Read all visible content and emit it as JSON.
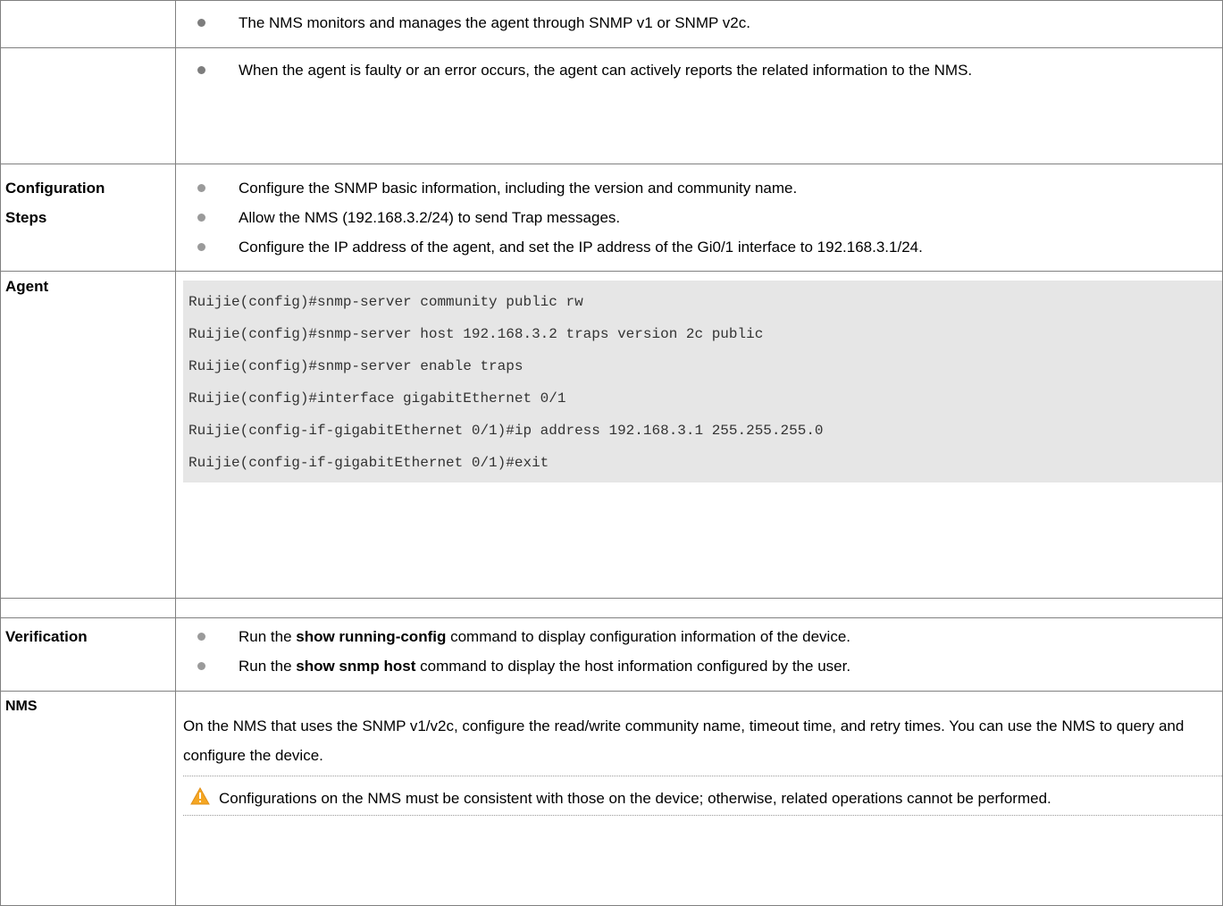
{
  "rows": {
    "r1": {
      "label": "",
      "bullets": [
        "The NMS monitors and manages the agent through SNMP v1 or SNMP v2c."
      ]
    },
    "r2": {
      "label": "",
      "bullets": [
        "When the agent is faulty or an error occurs, the agent can actively reports the related information to the NMS."
      ]
    },
    "config": {
      "label_line1": "Configuration",
      "label_line2": "Steps",
      "bullets": [
        "Configure the SNMP basic information, including the version and community name.",
        "Allow the NMS (192.168.3.2/24) to send Trap messages.",
        "Configure the IP address of the agent, and set the IP address of the Gi0/1 interface to 192.168.3.1/24."
      ]
    },
    "agent": {
      "label": "Agent",
      "code_lines": [
        "Ruijie(config)#snmp-server community public rw",
        "Ruijie(config)#snmp-server host 192.168.3.2 traps version 2c public",
        "Ruijie(config)#snmp-server enable traps",
        "Ruijie(config)#interface gigabitEthernet 0/1",
        "Ruijie(config-if-gigabitEthernet 0/1)#ip address 192.168.3.1 255.255.255.0",
        "Ruijie(config-if-gigabitEthernet 0/1)#exit"
      ]
    },
    "verification": {
      "label": "Verification",
      "items": [
        {
          "pre": "Run the ",
          "cmd": "show running-config",
          "post": " command to display configuration information of the device."
        },
        {
          "pre": "Run the ",
          "cmd": "show snmp host",
          "post": " command to display the host information configured by the user."
        }
      ]
    },
    "nms": {
      "label": "NMS",
      "paragraph": "On the NMS that uses the SNMP v1/v2c, configure the read/write community name, timeout time, and retry times. You can use the NMS to query and configure the device.",
      "note": "Configurations on the NMS must be consistent with those on the device; otherwise, related operations cannot be performed.",
      "note_icon": "warning-icon"
    }
  },
  "colors": {
    "border": "#808080",
    "code_bg": "#e6e6e6",
    "bullet": "#9a9a9a",
    "warning": "#f5a623"
  }
}
